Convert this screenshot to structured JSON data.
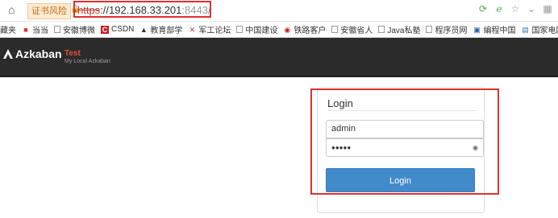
{
  "browser": {
    "warning_badge": "证书风险",
    "url_scheme": "https",
    "url_host": "://192.168.33.201",
    "url_port": ":8443/",
    "bookmarks": [
      {
        "label": "藏夹",
        "icon": "folder-icon"
      },
      {
        "label": "当当",
        "icon": "dangdang-icon"
      },
      {
        "label": "安徽博微",
        "icon": "page-icon"
      },
      {
        "label": "CSDN",
        "icon": "csdn-icon"
      },
      {
        "label": "教育部学",
        "icon": "education-icon"
      },
      {
        "label": "军工论坛",
        "icon": "forum-icon"
      },
      {
        "label": "中国建设",
        "icon": "page-icon"
      },
      {
        "label": "铁路客户",
        "icon": "railway-icon"
      },
      {
        "label": "安徽省人",
        "icon": "page-icon"
      },
      {
        "label": "Java私塾",
        "icon": "page-icon"
      },
      {
        "label": "程序员网",
        "icon": "page-icon"
      },
      {
        "label": "编程中国",
        "icon": "program-icon"
      },
      {
        "label": "国家电网",
        "icon": "grid-icon"
      }
    ],
    "more": "»"
  },
  "azkaban": {
    "title": "Azkaban",
    "env_name": "Test",
    "env_desc": "My Local Azkaban"
  },
  "login": {
    "heading": "Login",
    "username_value": "admin",
    "password_mask": "●●●●●",
    "button_label": "Login"
  },
  "colors": {
    "header_bg": "#2b2b2b",
    "env_red": "#e84c3d",
    "button_blue": "#428bca",
    "highlight_red": "#e0302f"
  }
}
